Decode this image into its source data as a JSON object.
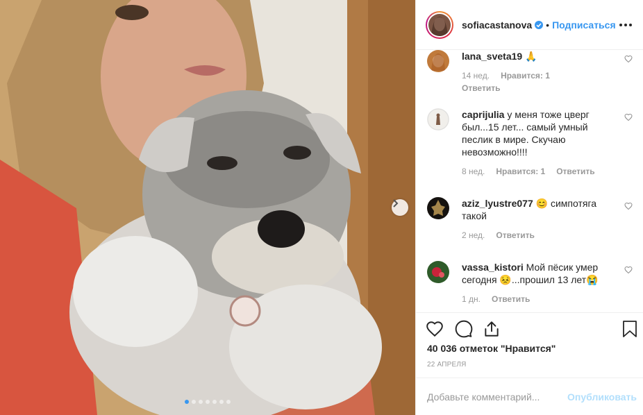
{
  "post": {
    "username": "sofiacastanova",
    "follow_label": "Подписаться",
    "separator": "•",
    "likes_text": "40 036 отметок \"Нравится\"",
    "date": "22 АПРЕЛЯ",
    "carousel_count": 7,
    "carousel_active": 1
  },
  "comments": [
    {
      "user": "lana_sveta19",
      "text": " 🙏",
      "time": "14 нед.",
      "likes": "Нравится: 1",
      "reply": "Ответить"
    },
    {
      "user": "caprijulia",
      "text": " у меня тоже цверг был...15 лет... самый умный песлик в мире. Скучаю невозможно!!!!",
      "time": "8 нед.",
      "likes": "Нравится: 1",
      "reply": "Ответить"
    },
    {
      "user": "aziz_lyustre077",
      "text": " 😊 симпотяга такой",
      "time": "2 нед.",
      "likes": "",
      "reply": "Ответить"
    },
    {
      "user": "vassa_kistori",
      "text": " Мой пёсик умер сегодня 😣...прошил 13 лет😭",
      "time": "1 дн.",
      "likes": "",
      "reply": "Ответить"
    }
  ],
  "add_comment": {
    "placeholder": "Добавьте комментарий...",
    "publish_label": "Опубликовать"
  },
  "colors": {
    "accent": "#3897f0",
    "text": "#262626",
    "muted": "#999999",
    "publish_disabled": "#b2dffc"
  },
  "icons": [
    "verified-badge-icon",
    "more-options-icon",
    "heart-icon",
    "comment-icon",
    "share-icon",
    "bookmark-icon",
    "chevron-right-icon"
  ]
}
